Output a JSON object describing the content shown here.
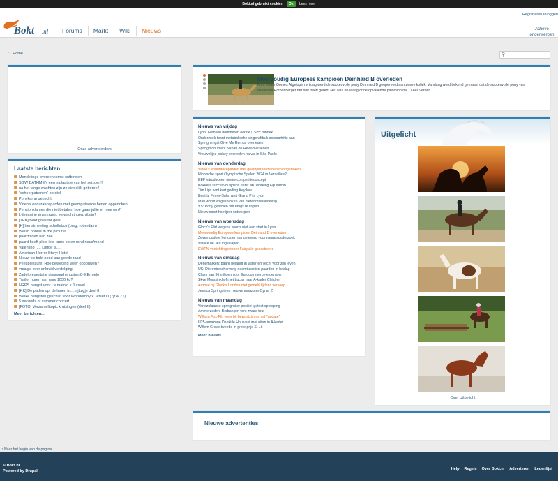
{
  "cookie": {
    "text": "Bokt.nl gebruikt cookies",
    "ok": "Ok",
    "more": "Lees meer"
  },
  "header": {
    "logo_text": "Bokt.nl",
    "nav": [
      "Forums",
      "Markt",
      "Wiki",
      "Nieuws"
    ],
    "active_nav": "Nieuws",
    "reg_links": "Registreren  Inloggen",
    "actief": "Actieve onderwerpen"
  },
  "breadcrumb": {
    "home": "Home"
  },
  "ads": {
    "caption": "Onze adverteerders"
  },
  "recent": {
    "title": "Laatste berichten",
    "items": [
      "Mondelinge overeenkomst ontbinden",
      "SGW BATHMEN een na laatste van het seizoen!!",
      "na het lange wachten zijn ze eindelijk geboren!!",
      "\"scheerpatronen\" borstel",
      "Ponykamp gezocht",
      "Video's enduranceparden met geamputeerde benen opgedoken",
      "Pensionklanten die niet betalen, hoe gaan jullie er mee om?",
      "L-theanine ervaringen, verwachtingen, ritalin?",
      "[TEK] Bokt goes for gold!",
      "[H] herfstmeeting schollebos (omg. rotterdam)",
      "Welsh ponies in the picture!",
      "paardrijden aan zee",
      "paard heeft plots iets raars op en rond neus/mond",
      "Valentino ..... Liefde is.....",
      "American Horror Story: Hotel",
      "Nieuw op bokt nood aan goede raad",
      "Peesblessure: Hoe beweging weer opbouwen?",
      "vraagje over onkruid verdelging",
      "Zadelpresentatie dressuurhengsten 8-9 Ermelo",
      "Trailer huren van max 1050 kg?",
      "NRPS hengst voor Le matojo x Juravel",
      "[HK] De paden op, de lanen in.... rijtuigje deel 8",
      "Welke hengsten geschikt voor Wonderboy x Jetset D (7jr & Z1)",
      "5 seconds of summer concert",
      "[FOTO] Verzamelttopic kruisingen (deel II)"
    ],
    "more": "Meer berichten..."
  },
  "feature": {
    "title": "Meervoudig Europees kampioen Deinhard B overleden",
    "text": "Foto: Koen Gomes Afgelopen vrijdag werd de succesvolle pony Deinhard B geopereerd aan zware koliek. Vandaag werd bekend gemaakt dat de succesvolle pony van de familie Rothenberger het niet heeft gered. Het was de vraag of de opvallende palomino na... Lees verder"
  },
  "news": {
    "days": [
      {
        "title": "Nieuws van vrijdag",
        "items": [
          {
            "t": "Lyon: Fransen domineren eerste CSI5* rubriek",
            "hl": false
          },
          {
            "t": "Onderzoek toont metabolische vingerafdruk osteoartritis aan",
            "hl": false
          },
          {
            "t": "Springhengst Give Me Remus overleden",
            "hl": false
          },
          {
            "t": "Springmonument Nabab de Rêve overleden",
            "hl": false
          },
          {
            "t": "Vrouwelijke jockey overleden na val in São Paolo",
            "hl": false
          }
        ]
      },
      {
        "title": "Nieuws van donderdag",
        "items": [
          {
            "t": "Video's enduranceparden met geamputeerde benen opgedoken",
            "hl": true
          },
          {
            "t": "Hippische sport Olympische Spelen 2024 in Versailles?",
            "hl": false
          },
          {
            "t": "EEF introduceert nieuw competitieconcept",
            "hl": false
          },
          {
            "t": "Bokkers succesvol tijdens eerst NK Working Equitation",
            "hl": false
          },
          {
            "t": "Tim Lips wint kort geding Keyflow",
            "hl": false
          },
          {
            "t": "Beatriz Ferrer-Salat wint Grand Prix Lyon",
            "hl": false
          },
          {
            "t": "Man wordt vrijgesproken van dierenmishandeling",
            "hl": false
          },
          {
            "t": "VS: Pony gestolen om drugs te kopen",
            "hl": false
          },
          {
            "t": "Nieuw soort hoefijzer ontworpen",
            "hl": false
          }
        ]
      },
      {
        "title": "Nieuws van woensdag",
        "items": [
          {
            "t": "Glock's Flirt wegens koorts niet aan start in Lyon",
            "hl": false
          },
          {
            "t": "Meervoudig Europees kampioen Deinhard B overleden",
            "hl": true
          },
          {
            "t": "Zeven oudere hengsten aangeleverd voor najaarsonderzoek",
            "hl": false
          },
          {
            "t": "Vivace de Jeu ingeslapen",
            "hl": false
          },
          {
            "t": "KWPN verrichtingstopper Fairytale gecastreerd",
            "hl": true
          }
        ]
      },
      {
        "title": "Nieuws van dinsdag",
        "items": [
          {
            "t": "Denemarken: paard belandt in water en vecht voor zijn leven",
            "hl": false
          },
          {
            "t": "UK: Dierenbescherming neemt zestien paarden in beslag",
            "hl": false
          },
          {
            "t": "Claim van 36 miljoen voor Eurocommerce-eigenaren",
            "hl": false
          },
          {
            "t": "Skye Morssinkhof met Lucas naar A-kader Children",
            "hl": false
          },
          {
            "t": "Artrose bij Glock's London niet gemeld tijdens verkoop",
            "hl": true
          },
          {
            "t": "Jessica Springsteen nieuwe amazone Cynar Z",
            "hl": false
          }
        ]
      },
      {
        "title": "Nieuws van maandag",
        "items": [
          {
            "t": "Venezolaanse springruiter positief getest op doping",
            "hl": false
          },
          {
            "t": "Ammerzoden: Berbançon wint zware tour",
            "hl": false
          },
          {
            "t": "William Fox-Pitt weer bij bewustzijn na val *update*",
            "hl": true
          },
          {
            "t": "U25-amazone Daniëlle Houtvast met uitan in A-kader",
            "hl": false
          },
          {
            "t": "Willem Greve tweede in grote prijs St Lô",
            "hl": false
          }
        ]
      }
    ],
    "more": "Meer nieuws..."
  },
  "uitgelicht": {
    "title": "Uitgelicht",
    "caption": "Over Uitgelicht"
  },
  "ads2": {
    "title": "Nieuwe advertenties"
  },
  "backtop": "↑ Naar het begin van de pagina",
  "footer": {
    "copy": "© Bokt.nl",
    "powered": "Powered by Drupal",
    "links": [
      "Help",
      "Regels",
      "Over Bokt.nl",
      "Adverteren",
      "Ledenlijst"
    ]
  },
  "colors": {
    "accent": "#e07020",
    "link": "#2d5b7a",
    "panel_border": "#2e7fb3",
    "footer": "#23425a"
  }
}
